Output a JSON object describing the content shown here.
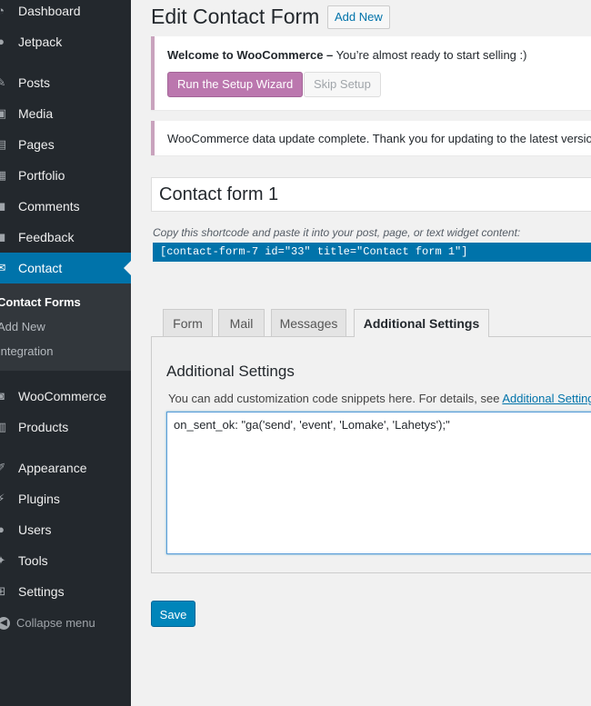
{
  "sidebar": {
    "items": [
      {
        "label": "Dashboard",
        "icon": "dashboard-icon",
        "glyph": "◔"
      },
      {
        "label": "Jetpack",
        "icon": "jetpack-icon",
        "glyph": "●"
      },
      {
        "label": "Posts",
        "icon": "pin-icon",
        "glyph": "✎"
      },
      {
        "label": "Media",
        "icon": "media-icon",
        "glyph": "▣"
      },
      {
        "label": "Pages",
        "icon": "pages-icon",
        "glyph": "▤"
      },
      {
        "label": "Portfolio",
        "icon": "portfolio-icon",
        "glyph": "▦"
      },
      {
        "label": "Comments",
        "icon": "comment-icon",
        "glyph": "◼"
      },
      {
        "label": "Feedback",
        "icon": "feedback-icon",
        "glyph": "◼"
      },
      {
        "label": "Contact",
        "icon": "mail-icon",
        "glyph": "✉"
      },
      {
        "label": "WooCommerce",
        "icon": "woocommerce-icon",
        "glyph": "◙"
      },
      {
        "label": "Products",
        "icon": "products-icon",
        "glyph": "▥"
      },
      {
        "label": "Appearance",
        "icon": "brush-icon",
        "glyph": "✐"
      },
      {
        "label": "Plugins",
        "icon": "plug-icon",
        "glyph": "⚡"
      },
      {
        "label": "Users",
        "icon": "user-icon",
        "glyph": "●"
      },
      {
        "label": "Tools",
        "icon": "wrench-icon",
        "glyph": "✦"
      },
      {
        "label": "Settings",
        "icon": "settings-icon",
        "glyph": "⊞"
      }
    ],
    "submenu": [
      "Contact Forms",
      "Add New",
      "Integration"
    ],
    "collapse_label": "Collapse menu",
    "collapse_glyph": "◀"
  },
  "header": {
    "title": "Edit Contact Form",
    "add_new": "Add New"
  },
  "notice_setup": {
    "strong": "Welcome to WooCommerce –",
    "text": " You’re almost ready to start selling :)",
    "wizard_button": "Run the Setup Wizard",
    "skip_button": "Skip Setup"
  },
  "notice_update": {
    "text": "WooCommerce data update complete. Thank you for updating to the latest version!"
  },
  "form": {
    "title_value": "Contact form 1",
    "shortcode_help": "Copy this shortcode and paste it into your post, page, or text widget content:",
    "shortcode": "[contact-form-7 id=\"33\" title=\"Contact form 1\"]"
  },
  "tabs": [
    "Form",
    "Mail",
    "Messages",
    "Additional Settings"
  ],
  "panel": {
    "title": "Additional Settings",
    "desc": "You can add customization code snippets here. For details, see ",
    "link": "Additional Settings",
    "code": "on_sent_ok: \"ga('send', 'event', 'Lomake', 'Lahetys');\""
  },
  "save_label": "Save",
  "colors": {
    "sidebar_bg": "#23282d",
    "accent": "#0073aa",
    "woo_purple": "#bb77ae"
  }
}
